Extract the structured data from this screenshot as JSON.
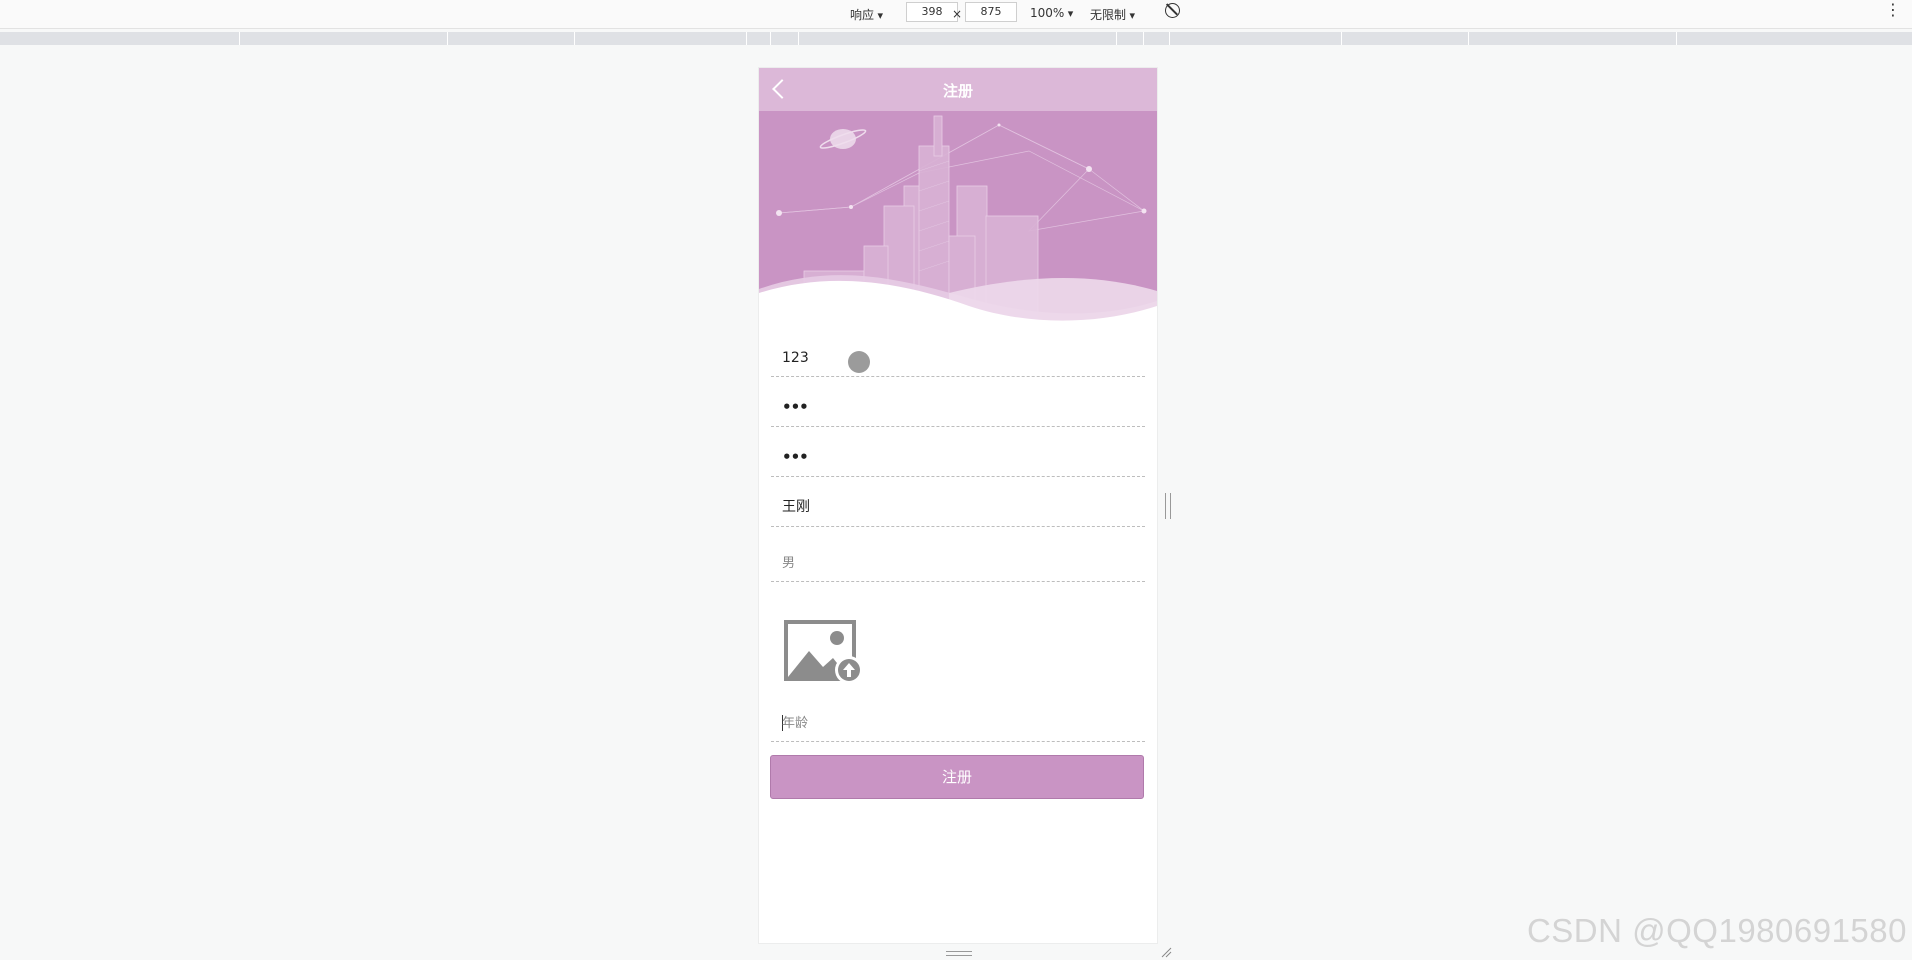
{
  "devtools": {
    "device_mode": "响应",
    "width": "398",
    "times": "×",
    "height": "875",
    "zoom": "100%",
    "throttle": "无限制",
    "more": "⋮"
  },
  "app": {
    "title": "注册",
    "form": {
      "username": "123",
      "password": "•••",
      "confirm_password": "•••",
      "name": "王刚",
      "gender": "男",
      "age_placeholder": "年龄"
    },
    "submit_label": "注册",
    "colors": {
      "navbar": "#dcb8d8",
      "banner": "#c994c4",
      "button": "#c994c4"
    }
  },
  "watermark": "CSDN @QQ1980691580"
}
